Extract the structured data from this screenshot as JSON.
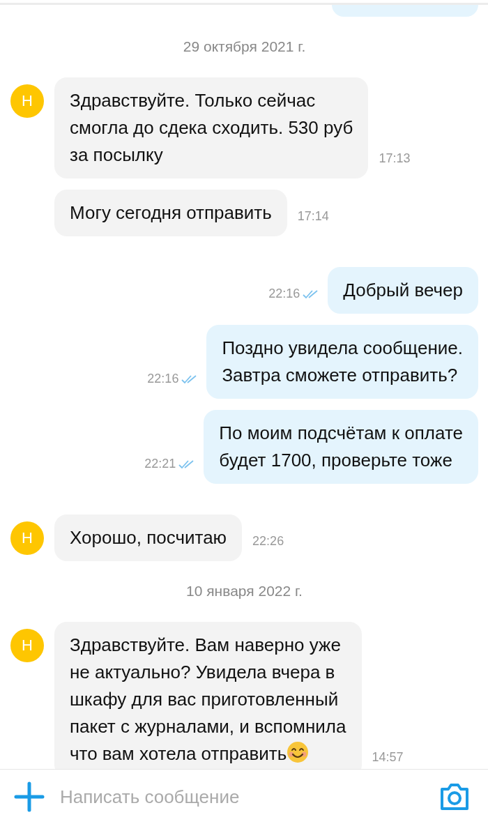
{
  "items": [
    {
      "kind": "fragment",
      "outgoing": true
    },
    {
      "kind": "date",
      "text": "29 октября 2021 г."
    },
    {
      "kind": "message",
      "outgoing": false,
      "avatar": "Н",
      "lines": [
        "Здравствуйте. Только сейчас",
        "смогла до сдека сходить. 530 руб",
        "за посылку"
      ],
      "time": "17:13"
    },
    {
      "kind": "message",
      "outgoing": false,
      "lines": [
        "Могу сегодня отправить"
      ],
      "time": "17:14"
    },
    {
      "kind": "message",
      "outgoing": true,
      "lines": [
        "Добрый вечер"
      ],
      "time": "22:16",
      "read": true
    },
    {
      "kind": "message",
      "outgoing": true,
      "lines": [
        "Поздно увидела сообщение.",
        "Завтра сможете отправить?"
      ],
      "time": "22:16",
      "read": true
    },
    {
      "kind": "message",
      "outgoing": true,
      "lines": [
        "По моим подсчётам к оплате",
        "будет 1700, проверьте тоже"
      ],
      "time": "22:21",
      "read": true
    },
    {
      "kind": "message",
      "outgoing": false,
      "avatar": "Н",
      "lines": [
        "Хорошо, посчитаю"
      ],
      "time": "22:26"
    },
    {
      "kind": "date",
      "text": "10 января 2022 г."
    },
    {
      "kind": "message",
      "outgoing": false,
      "avatar": "Н",
      "lines": [
        "Здравствуйте. Вам наверно уже",
        "не актуально? Увидела вчера в",
        "шкафу для вас приготовленный",
        "пакет с журналами, и вспомнила",
        "что вам хотела отправить"
      ],
      "emoji": true,
      "time": "14:57"
    }
  ],
  "composer": {
    "placeholder": "Написать сообщение"
  }
}
